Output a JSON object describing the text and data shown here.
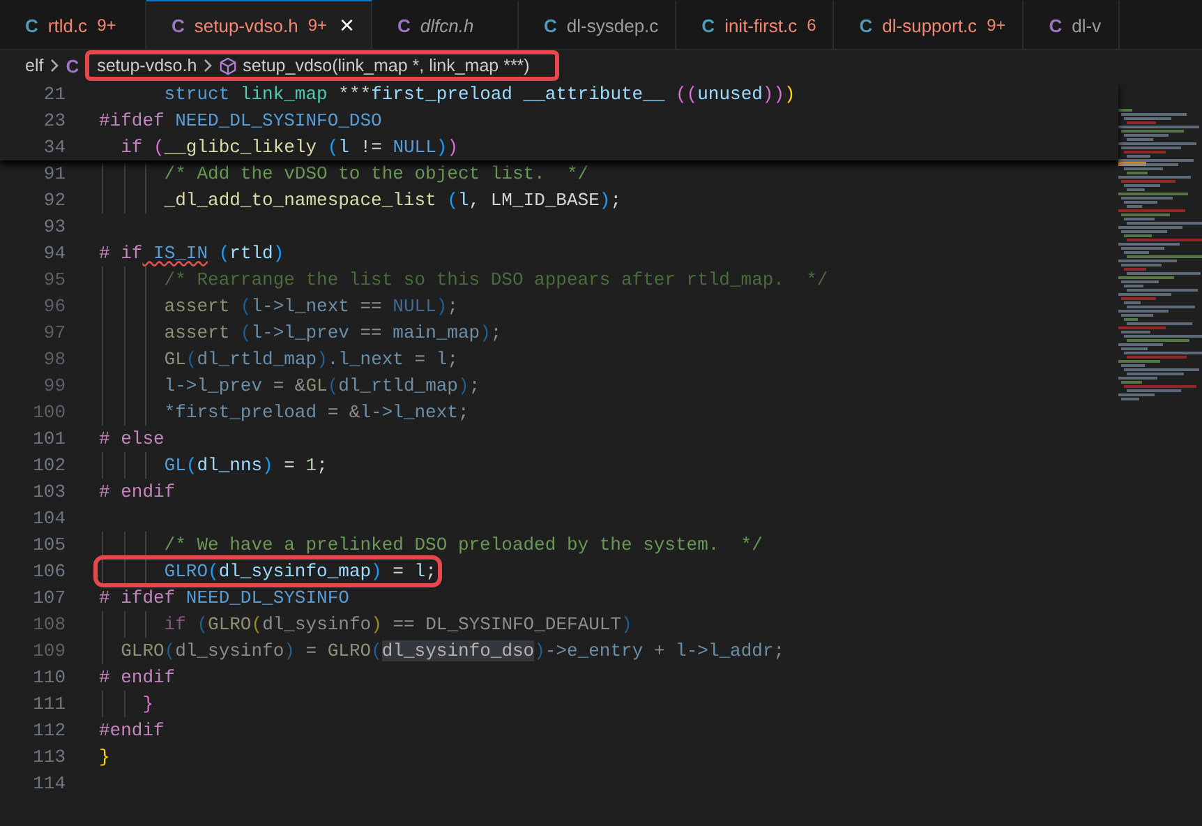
{
  "tabs": [
    {
      "icon": "C",
      "kind": "c",
      "label": "rtld.c",
      "problems": "9+",
      "has_errors": true,
      "preview": false,
      "selected": false
    },
    {
      "icon": "C",
      "kind": "h",
      "label": "setup-vdso.h",
      "problems": "9+",
      "has_errors": true,
      "preview": false,
      "selected": true,
      "close": "×"
    },
    {
      "icon": "C",
      "kind": "h",
      "label": "dlfcn.h",
      "has_errors": false,
      "preview": true,
      "selected": false
    },
    {
      "icon": "C",
      "kind": "c",
      "label": "dl-sysdep.c",
      "has_errors": false,
      "preview": false,
      "selected": false
    },
    {
      "icon": "C",
      "kind": "c",
      "label": "init-first.c",
      "problems": "6",
      "has_errors": true,
      "preview": false,
      "selected": false
    },
    {
      "icon": "C",
      "kind": "c",
      "label": "dl-support.c",
      "problems": "9+",
      "has_errors": true,
      "preview": false,
      "selected": false
    },
    {
      "icon": "C",
      "kind": "h",
      "label": "dl-v",
      "has_errors": false,
      "preview": false,
      "selected": false
    }
  ],
  "breadcrumb": {
    "annotated": true,
    "items": [
      {
        "kind": "folder",
        "label": "elf"
      },
      {
        "kind": "file",
        "icon": "C",
        "label": "setup-vdso.h"
      },
      {
        "kind": "symbol",
        "label": "setup_vdso(link_map *, link_map ***)"
      }
    ]
  },
  "sticky_lines": [
    {
      "n": "21",
      "tokens": [
        {
          "kind": "code",
          "t": "      struct",
          "color": "#569cd6"
        },
        {
          "kind": "code",
          "t": " link_map",
          "color": "#4ec9b0"
        },
        {
          "kind": "code",
          "t": " ***",
          "color": "#d4d4d4"
        },
        {
          "kind": "code",
          "t": "first_preload",
          "color": "#9cdcfe"
        },
        {
          "kind": "code",
          "t": " __attribute__",
          "color": "#9cdcfe"
        },
        {
          "kind": "code",
          "t": " ((",
          "color": "#da70d6"
        },
        {
          "kind": "code",
          "t": "unused",
          "color": "#9cdcfe"
        },
        {
          "kind": "code",
          "t": "))",
          "color": "#da70d6"
        },
        {
          "kind": "code",
          "t": ")",
          "color": "#ffd700"
        }
      ]
    },
    {
      "n": "23",
      "tokens": [
        {
          "kind": "code",
          "t": "#ifdef",
          "color": "#c586c0"
        },
        {
          "kind": "code",
          "t": " NEED_DL_SYSINFO_DSO",
          "color": "#569cd6"
        }
      ]
    },
    {
      "n": "34",
      "tokens": [
        {
          "kind": "code",
          "t": "  if",
          "color": "#c586c0"
        },
        {
          "kind": "code",
          "t": " (",
          "color": "#da70d6"
        },
        {
          "kind": "code",
          "t": "__glibc_likely",
          "color": "#dcdcaa"
        },
        {
          "kind": "code",
          "t": " (",
          "color": "#179fff"
        },
        {
          "kind": "code",
          "t": "l",
          "color": "#9cdcfe"
        },
        {
          "kind": "code",
          "t": " != ",
          "color": "#d4d4d4"
        },
        {
          "kind": "code",
          "t": "NULL",
          "color": "#569cd6"
        },
        {
          "kind": "code",
          "t": ")",
          "color": "#179fff"
        },
        {
          "kind": "code",
          "t": ")",
          "color": "#da70d6"
        }
      ]
    }
  ],
  "lines": [
    {
      "n": "91",
      "inactive": false,
      "annotated": false,
      "tokens": [
        {
          "kind": "code",
          "t": "      /* Add the vDSO to the object list.  */",
          "color": "#6a9955"
        }
      ]
    },
    {
      "n": "92",
      "inactive": false,
      "annotated": false,
      "tokens": [
        {
          "kind": "code",
          "t": "      _dl_add_to_namespace_list",
          "color": "#dcdcaa"
        },
        {
          "kind": "code",
          "t": " (",
          "color": "#179fff"
        },
        {
          "kind": "code",
          "t": "l",
          "color": "#9cdcfe"
        },
        {
          "kind": "code",
          "t": ", LM_ID_BASE",
          "color": "#d4d4d4"
        },
        {
          "kind": "code",
          "t": ")",
          "color": "#179fff"
        },
        {
          "kind": "code",
          "t": ";",
          "color": "#d4d4d4"
        }
      ]
    },
    {
      "n": "93",
      "inactive": false,
      "annotated": false
    },
    {
      "n": "94",
      "inactive": false,
      "annotated": false,
      "tokens": [
        {
          "kind": "code",
          "t": "# if",
          "color": "#c586c0"
        },
        {
          "kind": "error",
          "t": " IS_IN",
          "color": "#569cd6"
        },
        {
          "kind": "code",
          "t": " (",
          "color": "#179fff"
        },
        {
          "kind": "code",
          "t": "rtld",
          "color": "#9cdcfe"
        },
        {
          "kind": "code",
          "t": ")",
          "color": "#179fff"
        }
      ]
    },
    {
      "n": "95",
      "inactive": true,
      "annotated": false,
      "tokens": [
        {
          "kind": "code",
          "t": "      /* Rearrange the list so this DSO appears after rtld_map.  */",
          "color": "#4a6b3c"
        }
      ]
    },
    {
      "n": "96",
      "inactive": true,
      "annotated": false,
      "tokens": [
        {
          "kind": "code",
          "t": "      assert",
          "color": "#8f8f75"
        },
        {
          "kind": "code",
          "t": " (",
          "color": "#1e5f94"
        },
        {
          "kind": "code",
          "t": "l->l_next",
          "color": "#6b8fa8"
        },
        {
          "kind": "code",
          "t": " == ",
          "color": "#8c8c8c"
        },
        {
          "kind": "code",
          "t": "NULL",
          "color": "#3f6a91"
        },
        {
          "kind": "code",
          "t": ")",
          "color": "#1e5f94"
        },
        {
          "kind": "code",
          "t": ";",
          "color": "#8c8c8c"
        }
      ]
    },
    {
      "n": "97",
      "inactive": true,
      "annotated": false,
      "tokens": [
        {
          "kind": "code",
          "t": "      assert",
          "color": "#8f8f75"
        },
        {
          "kind": "code",
          "t": " (",
          "color": "#1e5f94"
        },
        {
          "kind": "code",
          "t": "l->l_prev",
          "color": "#6b8fa8"
        },
        {
          "kind": "code",
          "t": " == ",
          "color": "#8c8c8c"
        },
        {
          "kind": "code",
          "t": "main_map",
          "color": "#6b8fa8"
        },
        {
          "kind": "code",
          "t": ")",
          "color": "#1e5f94"
        },
        {
          "kind": "code",
          "t": ";",
          "color": "#8c8c8c"
        }
      ]
    },
    {
      "n": "98",
      "inactive": true,
      "annotated": false,
      "tokens": [
        {
          "kind": "code",
          "t": "      GL",
          "color": "#8f8f75"
        },
        {
          "kind": "code",
          "t": "(",
          "color": "#1e5f94"
        },
        {
          "kind": "code",
          "t": "dl_rtld_map",
          "color": "#6b8fa8"
        },
        {
          "kind": "code",
          "t": ")",
          "color": "#1e5f94"
        },
        {
          "kind": "code",
          "t": ".l_next",
          "color": "#6b8fa8"
        },
        {
          "kind": "code",
          "t": " = ",
          "color": "#8c8c8c"
        },
        {
          "kind": "code",
          "t": "l",
          "color": "#6b8fa8"
        },
        {
          "kind": "code",
          "t": ";",
          "color": "#8c8c8c"
        }
      ]
    },
    {
      "n": "99",
      "inactive": true,
      "annotated": false,
      "tokens": [
        {
          "kind": "code",
          "t": "      l->l_prev",
          "color": "#6b8fa8"
        },
        {
          "kind": "code",
          "t": " = &",
          "color": "#8c8c8c"
        },
        {
          "kind": "code",
          "t": "GL",
          "color": "#8f8f75"
        },
        {
          "kind": "code",
          "t": "(",
          "color": "#1e5f94"
        },
        {
          "kind": "code",
          "t": "dl_rtld_map",
          "color": "#6b8fa8"
        },
        {
          "kind": "code",
          "t": ")",
          "color": "#1e5f94"
        },
        {
          "kind": "code",
          "t": ";",
          "color": "#8c8c8c"
        }
      ]
    },
    {
      "n": "100",
      "inactive": true,
      "annotated": false,
      "tokens": [
        {
          "kind": "code",
          "t": "      *first_preload",
          "color": "#6b8fa8"
        },
        {
          "kind": "code",
          "t": " = &",
          "color": "#8c8c8c"
        },
        {
          "kind": "code",
          "t": "l->l_next",
          "color": "#6b8fa8"
        },
        {
          "kind": "code",
          "t": ";",
          "color": "#8c8c8c"
        }
      ]
    },
    {
      "n": "101",
      "inactive": false,
      "annotated": false,
      "tokens": [
        {
          "kind": "code",
          "t": "# else",
          "color": "#c586c0"
        }
      ]
    },
    {
      "n": "102",
      "inactive": false,
      "annotated": false,
      "tokens": [
        {
          "kind": "code",
          "t": "      GL",
          "color": "#569cd6"
        },
        {
          "kind": "code",
          "t": "(",
          "color": "#179fff"
        },
        {
          "kind": "code",
          "t": "dl_nns",
          "color": "#9cdcfe"
        },
        {
          "kind": "code",
          "t": ")",
          "color": "#179fff"
        },
        {
          "kind": "code",
          "t": " = ",
          "color": "#d4d4d4"
        },
        {
          "kind": "code",
          "t": "1",
          "color": "#b5cea8"
        },
        {
          "kind": "code",
          "t": ";",
          "color": "#d4d4d4"
        }
      ]
    },
    {
      "n": "103",
      "inactive": false,
      "annotated": false,
      "tokens": [
        {
          "kind": "code",
          "t": "# endif",
          "color": "#c586c0"
        }
      ]
    },
    {
      "n": "104",
      "inactive": false,
      "annotated": false
    },
    {
      "n": "105",
      "inactive": false,
      "annotated": false,
      "tokens": [
        {
          "kind": "code",
          "t": "      /* We have a prelinked DSO preloaded by the system.  */",
          "color": "#6a9955"
        }
      ]
    },
    {
      "n": "106",
      "inactive": false,
      "annotated": true,
      "tokens": [
        {
          "kind": "code",
          "t": "      GLRO",
          "color": "#569cd6"
        },
        {
          "kind": "code",
          "t": "(",
          "color": "#179fff"
        },
        {
          "kind": "code",
          "t": "dl_sysinfo_map",
          "color": "#9cdcfe"
        },
        {
          "kind": "code",
          "t": ")",
          "color": "#179fff"
        },
        {
          "kind": "code",
          "t": " = ",
          "color": "#d4d4d4"
        },
        {
          "kind": "code",
          "t": "l",
          "color": "#9cdcfe"
        },
        {
          "kind": "code",
          "t": ";",
          "color": "#d4d4d4"
        }
      ]
    },
    {
      "n": "107",
      "inactive": false,
      "annotated": false,
      "tokens": [
        {
          "kind": "code",
          "t": "# ifdef",
          "color": "#c586c0"
        },
        {
          "kind": "code",
          "t": " NEED_DL_SYSINFO",
          "color": "#569cd6"
        }
      ]
    },
    {
      "n": "108",
      "inactive": true,
      "annotated": false,
      "tokens": [
        {
          "kind": "code",
          "t": "      if",
          "color": "#7f5a7c"
        },
        {
          "kind": "code",
          "t": " (",
          "color": "#1e5f94"
        },
        {
          "kind": "code",
          "t": "GLRO",
          "color": "#8f8f75"
        },
        {
          "kind": "code",
          "t": "(",
          "color": "#a08a1e"
        },
        {
          "kind": "code",
          "t": "dl_sysinfo",
          "color": "#8c8c8c"
        },
        {
          "kind": "code",
          "t": ")",
          "color": "#a08a1e"
        },
        {
          "kind": "code",
          "t": " == DL_SYSINFO_DEFAULT",
          "color": "#8c8c8c"
        },
        {
          "kind": "code",
          "t": ")",
          "color": "#1e5f94"
        }
      ]
    },
    {
      "n": "109",
      "inactive": true,
      "annotated": false,
      "tokens": [
        {
          "kind": "code",
          "t": "  GLRO",
          "color": "#8f8f75"
        },
        {
          "kind": "code",
          "t": "(",
          "color": "#1e5f94"
        },
        {
          "kind": "code",
          "t": "dl_sysinfo",
          "color": "#8c8c8c"
        },
        {
          "kind": "code",
          "t": ")",
          "color": "#1e5f94"
        },
        {
          "kind": "code",
          "t": " = ",
          "color": "#8c8c8c"
        },
        {
          "kind": "code",
          "t": "GLRO",
          "color": "#8f8f75"
        },
        {
          "kind": "code",
          "t": "(",
          "color": "#1e5f94"
        },
        {
          "kind": "match",
          "t": "dl_sysinfo_dso",
          "color": "#b4b4b4"
        },
        {
          "kind": "code",
          "t": ")",
          "color": "#1e5f94"
        },
        {
          "kind": "code",
          "t": "->e_entry",
          "color": "#6b8fa8"
        },
        {
          "kind": "code",
          "t": " + ",
          "color": "#8c8c8c"
        },
        {
          "kind": "code",
          "t": "l->l_addr",
          "color": "#6b8fa8"
        },
        {
          "kind": "code",
          "t": ";",
          "color": "#8c8c8c"
        }
      ]
    },
    {
      "n": "110",
      "inactive": false,
      "annotated": false,
      "tokens": [
        {
          "kind": "code",
          "t": "# endif",
          "color": "#c586c0"
        }
      ]
    },
    {
      "n": "111",
      "inactive": false,
      "annotated": false,
      "tokens": [
        {
          "kind": "code",
          "t": "    }",
          "color": "#da70d6"
        }
      ]
    },
    {
      "n": "112",
      "inactive": false,
      "annotated": false,
      "tokens": [
        {
          "kind": "code",
          "t": "#endif",
          "color": "#c586c0"
        }
      ]
    },
    {
      "n": "113",
      "inactive": false,
      "annotated": false,
      "tokens": [
        {
          "kind": "code",
          "t": "}",
          "color": "#ffd700"
        }
      ]
    },
    {
      "n": "114",
      "inactive": false,
      "annotated": false
    }
  ]
}
